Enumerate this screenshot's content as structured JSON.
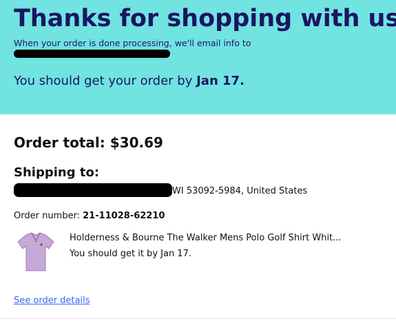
{
  "banner": {
    "title": "Thanks for shopping with us!",
    "email_notice": "When your order is done processing, we'll email info to",
    "delivery_prefix": "You should get your order by",
    "delivery_date": "Jan 17."
  },
  "order": {
    "total_label": "Order total: $30.69",
    "shipping_heading": "Shipping to:",
    "address_tail": "WI 53092-5984, United States",
    "number_label": "Order number:",
    "number_value": "21-11028-62210"
  },
  "item": {
    "title": "Holderness & Bourne The Walker Mens Polo Golf Shirt Whit...",
    "eta": "You should get it by Jan 17.",
    "icon": "polo-shirt-thumbnail"
  },
  "links": {
    "see_order_details": "See order details"
  },
  "colors": {
    "banner_bg": "#71e3e1",
    "banner_text": "#1a1562",
    "link": "#3665f3"
  }
}
